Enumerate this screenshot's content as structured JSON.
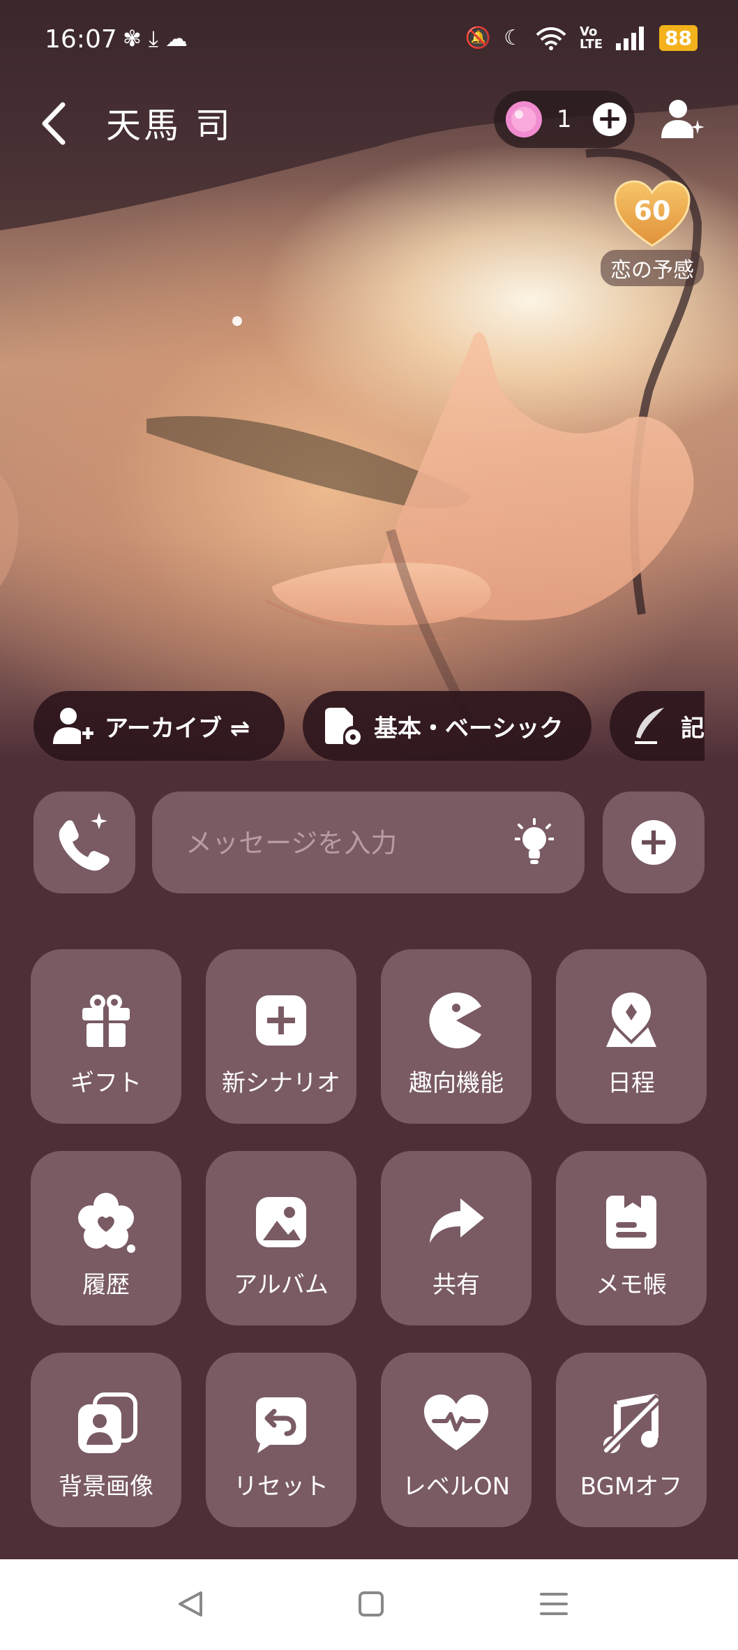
{
  "status_bar": {
    "time": "16:07",
    "battery": "88",
    "network_label": "Vo LTE"
  },
  "header": {
    "title": "天馬 司",
    "gem_count": "1"
  },
  "affinity": {
    "level": "60",
    "label": "恋の予感"
  },
  "chips": [
    {
      "label": "アーカイブ ⇌",
      "icon": "person-plus-icon"
    },
    {
      "label": "基本・ベーシック",
      "icon": "settings-doc-icon"
    },
    {
      "label": "記",
      "icon": "quill-icon"
    }
  ],
  "composer": {
    "placeholder": "メッセージを入力"
  },
  "grid": [
    {
      "label": "ギフト",
      "icon": "gift-icon"
    },
    {
      "label": "新シナリオ",
      "icon": "plus-square-icon"
    },
    {
      "label": "趣向機能",
      "icon": "pacman-icon"
    },
    {
      "label": "日程",
      "icon": "map-pin-icon"
    },
    {
      "label": "履歴",
      "icon": "heart-flower-icon"
    },
    {
      "label": "アルバム",
      "icon": "photo-icon"
    },
    {
      "label": "共有",
      "icon": "share-arrow-icon"
    },
    {
      "label": "メモ帳",
      "icon": "memo-icon"
    },
    {
      "label": "背景画像",
      "icon": "portrait-stack-icon"
    },
    {
      "label": "リセット",
      "icon": "reset-bubble-icon"
    },
    {
      "label": "レベルON",
      "icon": "heart-pulse-icon"
    },
    {
      "label": "BGMオフ",
      "icon": "music-off-icon"
    }
  ],
  "colors": {
    "background": "#4e2e37",
    "tile": "#7a5b63",
    "chip": "#2d161c",
    "battery": "#f3b21c"
  }
}
